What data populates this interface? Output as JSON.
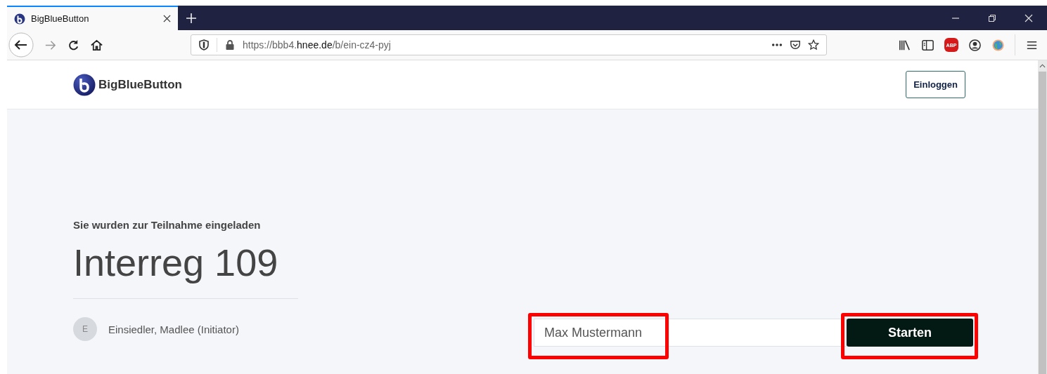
{
  "browser": {
    "tab": {
      "title": "BigBlueButton",
      "selected": true
    },
    "url": {
      "prefix": "https://bbb4.",
      "domain": "hnee.de",
      "path": "/b/ein-cz4-pyj"
    },
    "extension_badge": "ABP"
  },
  "header": {
    "logo_text": "BigBlueButton",
    "login_button": "Einloggen"
  },
  "room": {
    "invite_text": "Sie wurden zur Teilnahme eingeladen",
    "title": "Interreg 109",
    "owner": {
      "initial": "E",
      "name": "Einsiedler, Madlee (Initiator)"
    }
  },
  "join_form": {
    "name_field": {
      "value": "Max Mustermann",
      "highlighted": true
    },
    "start_button": {
      "label": "Starten",
      "highlighted": true
    }
  }
}
